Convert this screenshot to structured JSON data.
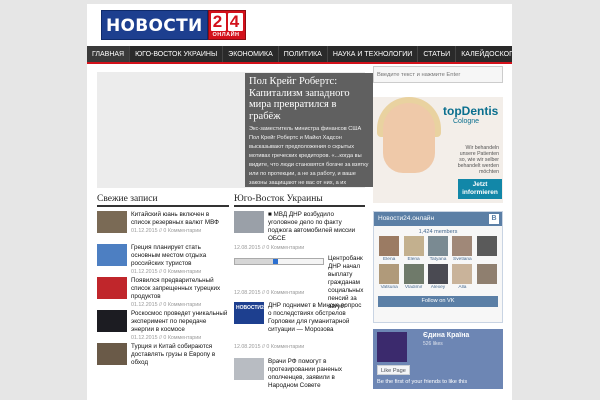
{
  "header": {
    "logo_text": "НОВОСТИ",
    "logo_digits": "24",
    "logo_sub": "ОНЛАЙН"
  },
  "nav": {
    "items": [
      {
        "label": "ГЛАВНАЯ"
      },
      {
        "label": "ЮГО-ВОСТОК УКРАИНЫ"
      },
      {
        "label": "ЭКОНОМИКА"
      },
      {
        "label": "ПОЛИТИКА"
      },
      {
        "label": "НАУКА И ТЕХНОЛОГИИ"
      },
      {
        "label": "СТАТЬИ"
      },
      {
        "label": "КАЛЕЙДОСКОП"
      }
    ]
  },
  "slider": {
    "title": "Пол Крейг Робертс: Капитализм западного мира превратился в грабёж",
    "text": "Экс-заместитель министра финансов США Пол Крейг Робертс и Майкл Хадсон высказывают предположения о скрытых мотивах греческих кредиторов. «...когда вы видите, что люди становятся богаче за взятку или по протекции, а не за работу, и ваше законы защищают не вас от них, а их"
  },
  "fresh": {
    "title": "Свежие записи",
    "items": [
      {
        "title": "Китайский юань включен в список резервных валют МВФ",
        "meta": "01.12.2015 // 0 Комментарии",
        "thumb_color": "#7a6a55"
      },
      {
        "title": "Греция планирует стать основным местом отдыха российских туристов",
        "meta": "01.12.2015 // 0 Комментарии",
        "thumb_color": "#4d7fc2"
      },
      {
        "title": "Появился предварительный список запрещенных турецких продуктов",
        "meta": "01.12.2015 // 0 Комментарии",
        "thumb_color": "#c0262b"
      },
      {
        "title": "Роскосмос проведет уникальный эксперимент по передаче энергии в космосе",
        "meta": "01.12.2015 // 0 Комментарии",
        "thumb_color": "#1c1c22"
      },
      {
        "title": "Турция и Китай собираются доставлять грузы в Европу в обход",
        "meta": "",
        "thumb_color": "#6a5a48"
      }
    ]
  },
  "southeast": {
    "title": "Юго-Восток Украины",
    "items": [
      {
        "title": "■ МВД ДНР возбудило уголовное дело по факту поджога автомобилей миссии ОБСЕ",
        "meta": "12.08.2015 // 0 Комментарии",
        "thumb_color": "#9aa0a8"
      },
      {
        "title": "Центробанк ДНР начал выплату гражданам социальных пенсий за август",
        "meta": "12.08.2015 // 0 Комментарии"
      },
      {
        "title": "ДНР поднимет в Минске вопрос о последствиях обстрелов Горловки для гуманитарной ситуации — Морозова",
        "meta": "12.08.2015 // 0 Комментарии"
      },
      {
        "title": "Врачи РФ помогут в протезировании раненых ополченцев, заявили в Народном Совете",
        "meta": "",
        "thumb_color": "#b8bcc2"
      }
    ],
    "progress": 0.45
  },
  "sidebar": {
    "search_placeholder": "Введите текст и нажмите Enter",
    "ad": {
      "brand": "topDentis",
      "sub": "Cologne",
      "text": "Wir behandeln unsere Patienten so, wie wir selber behandelt werden möchten",
      "button": "Jetzt informieren"
    },
    "vk": {
      "title": "Новости24.онлайн",
      "b": "В",
      "members": "1,424 members",
      "people": [
        {
          "name": "Elena",
          "color": "#9b7b63"
        },
        {
          "name": "Elena",
          "color": "#c3b08e"
        },
        {
          "name": "Tatyana",
          "color": "#7a8a92"
        },
        {
          "name": "Svetlana",
          "color": "#a08878"
        },
        {
          "name": "",
          "color": "#5a5a5a"
        },
        {
          "name": "Vatsuna",
          "color": "#b09a7a"
        },
        {
          "name": "Vladimir",
          "color": "#6f7a6a"
        },
        {
          "name": "Alexey",
          "color": "#4a4a52"
        },
        {
          "name": "Alla",
          "color": "#c9b39a"
        },
        {
          "name": "",
          "color": "#8f7f6f"
        }
      ],
      "follow": "Follow on VK"
    },
    "fb": {
      "name": "Єдина Країна",
      "likes": "526 likes",
      "like": "Like Page",
      "first": "Be the first of your friends to like this"
    }
  }
}
